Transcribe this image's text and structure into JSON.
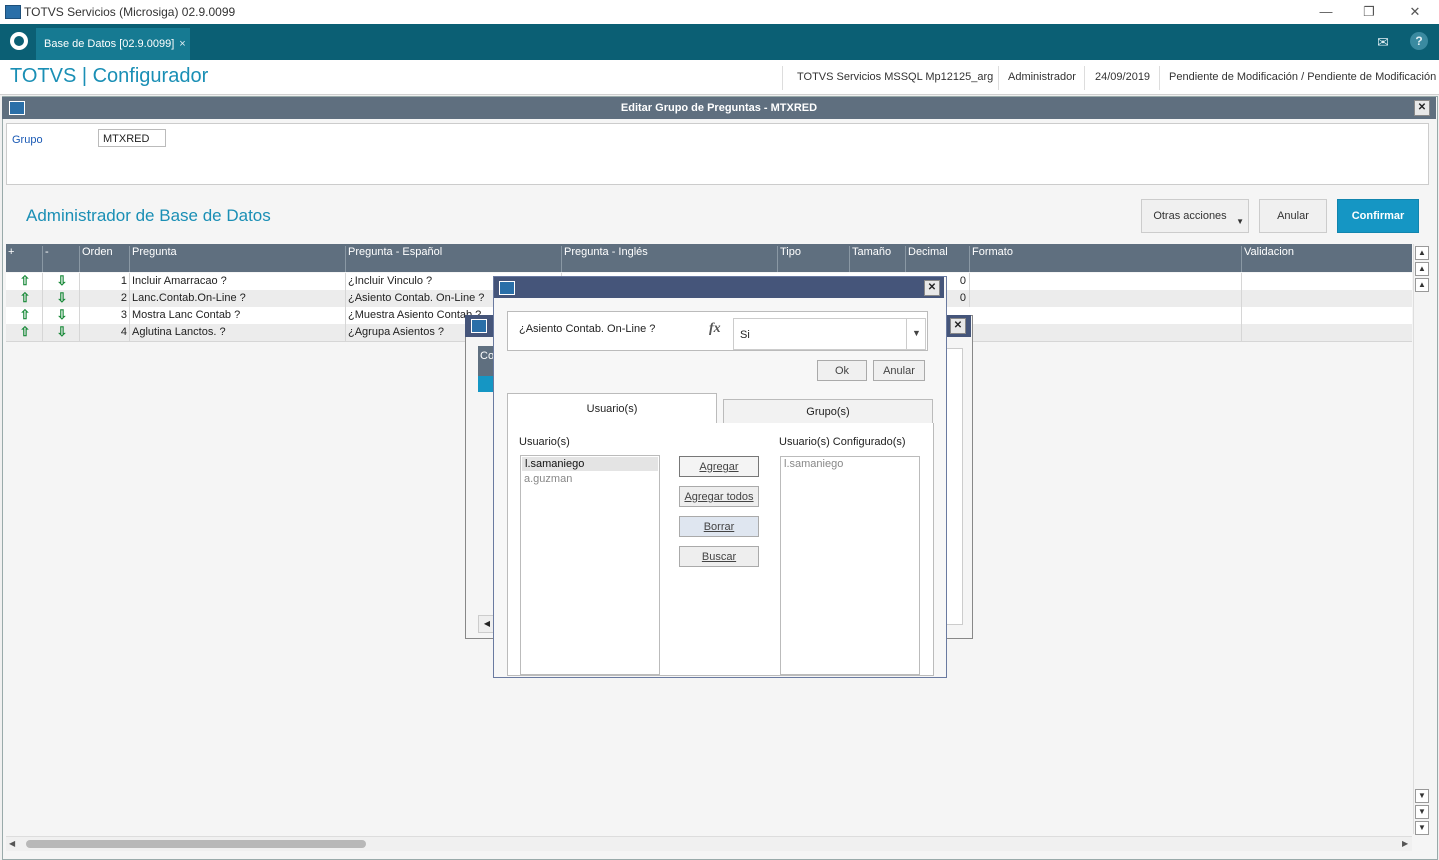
{
  "window": {
    "title": "TOTVS Servicios (Microsiga) 02.9.0099",
    "controls": [
      "—",
      "❐",
      "✕"
    ]
  },
  "tabbar": {
    "tab_label": "Base de Datos [02.9.0099]",
    "tab_close": "×",
    "mail_icon": "✉",
    "help_icon": "?"
  },
  "header": {
    "brand": "TOTVS | Configurador",
    "server": "TOTVS Servicios MSSQL Mp12125_arg",
    "user": "Administrador",
    "date": "24/09/2019",
    "status": "Pendiente de Modificación / Pendiente de Modificación"
  },
  "dialog": {
    "title": "Editar Grupo de Preguntas - MTXRED",
    "close": "✕",
    "grupo_label": "Grupo",
    "grupo_value": "MTXRED",
    "section_title": "Administrador de Base de Datos",
    "buttons": {
      "otras": "Otras acciones",
      "anular": "Anular",
      "confirmar": "Confirmar"
    }
  },
  "grid": {
    "headers": [
      "+",
      "-",
      "Orden",
      "Pregunta",
      "Pregunta - Español",
      "Pregunta - Inglés",
      "Tipo",
      "Tamaño",
      "Decimal",
      "Formato",
      "Validacion"
    ],
    "rows": [
      {
        "orden": "1",
        "pregunta": "Incluir Amarracao ?",
        "espanol": "¿Incluir Vinculo ?",
        "decimal": "0"
      },
      {
        "orden": "2",
        "pregunta": "Lanc.Contab.On-Line ?",
        "espanol": "¿Asiento Contab. On-Line ?",
        "decimal": "0"
      },
      {
        "orden": "3",
        "pregunta": "Mostra Lanc Contab ?",
        "espanol": "¿Muestra Asiento Contab ?",
        "decimal": ""
      },
      {
        "orden": "4",
        "pregunta": "Aglutina Lanctos. ?",
        "espanol": "¿Agrupa Asientos ?",
        "decimal": ""
      }
    ],
    "up_arrow": "⇧",
    "down_arrow": "⇩"
  },
  "behind_dialog": {
    "partial_label": "Co"
  },
  "popup": {
    "close": "✕",
    "question": "¿Asiento Contab. On-Line ?",
    "fx_icon": "fx",
    "value": "Si",
    "ok": "Ok",
    "anular": "Anular",
    "tabs": [
      "Usuario(s)",
      "Grupo(s)"
    ],
    "left_label": "Usuario(s)",
    "right_label": "Usuario(s) Configurado(s)",
    "users": [
      "l.samaniego",
      "a.guzman"
    ],
    "configured": [
      "l.samaniego"
    ],
    "actions": [
      "Agregar",
      "Agregar todos",
      "Borrar",
      "Buscar"
    ]
  }
}
